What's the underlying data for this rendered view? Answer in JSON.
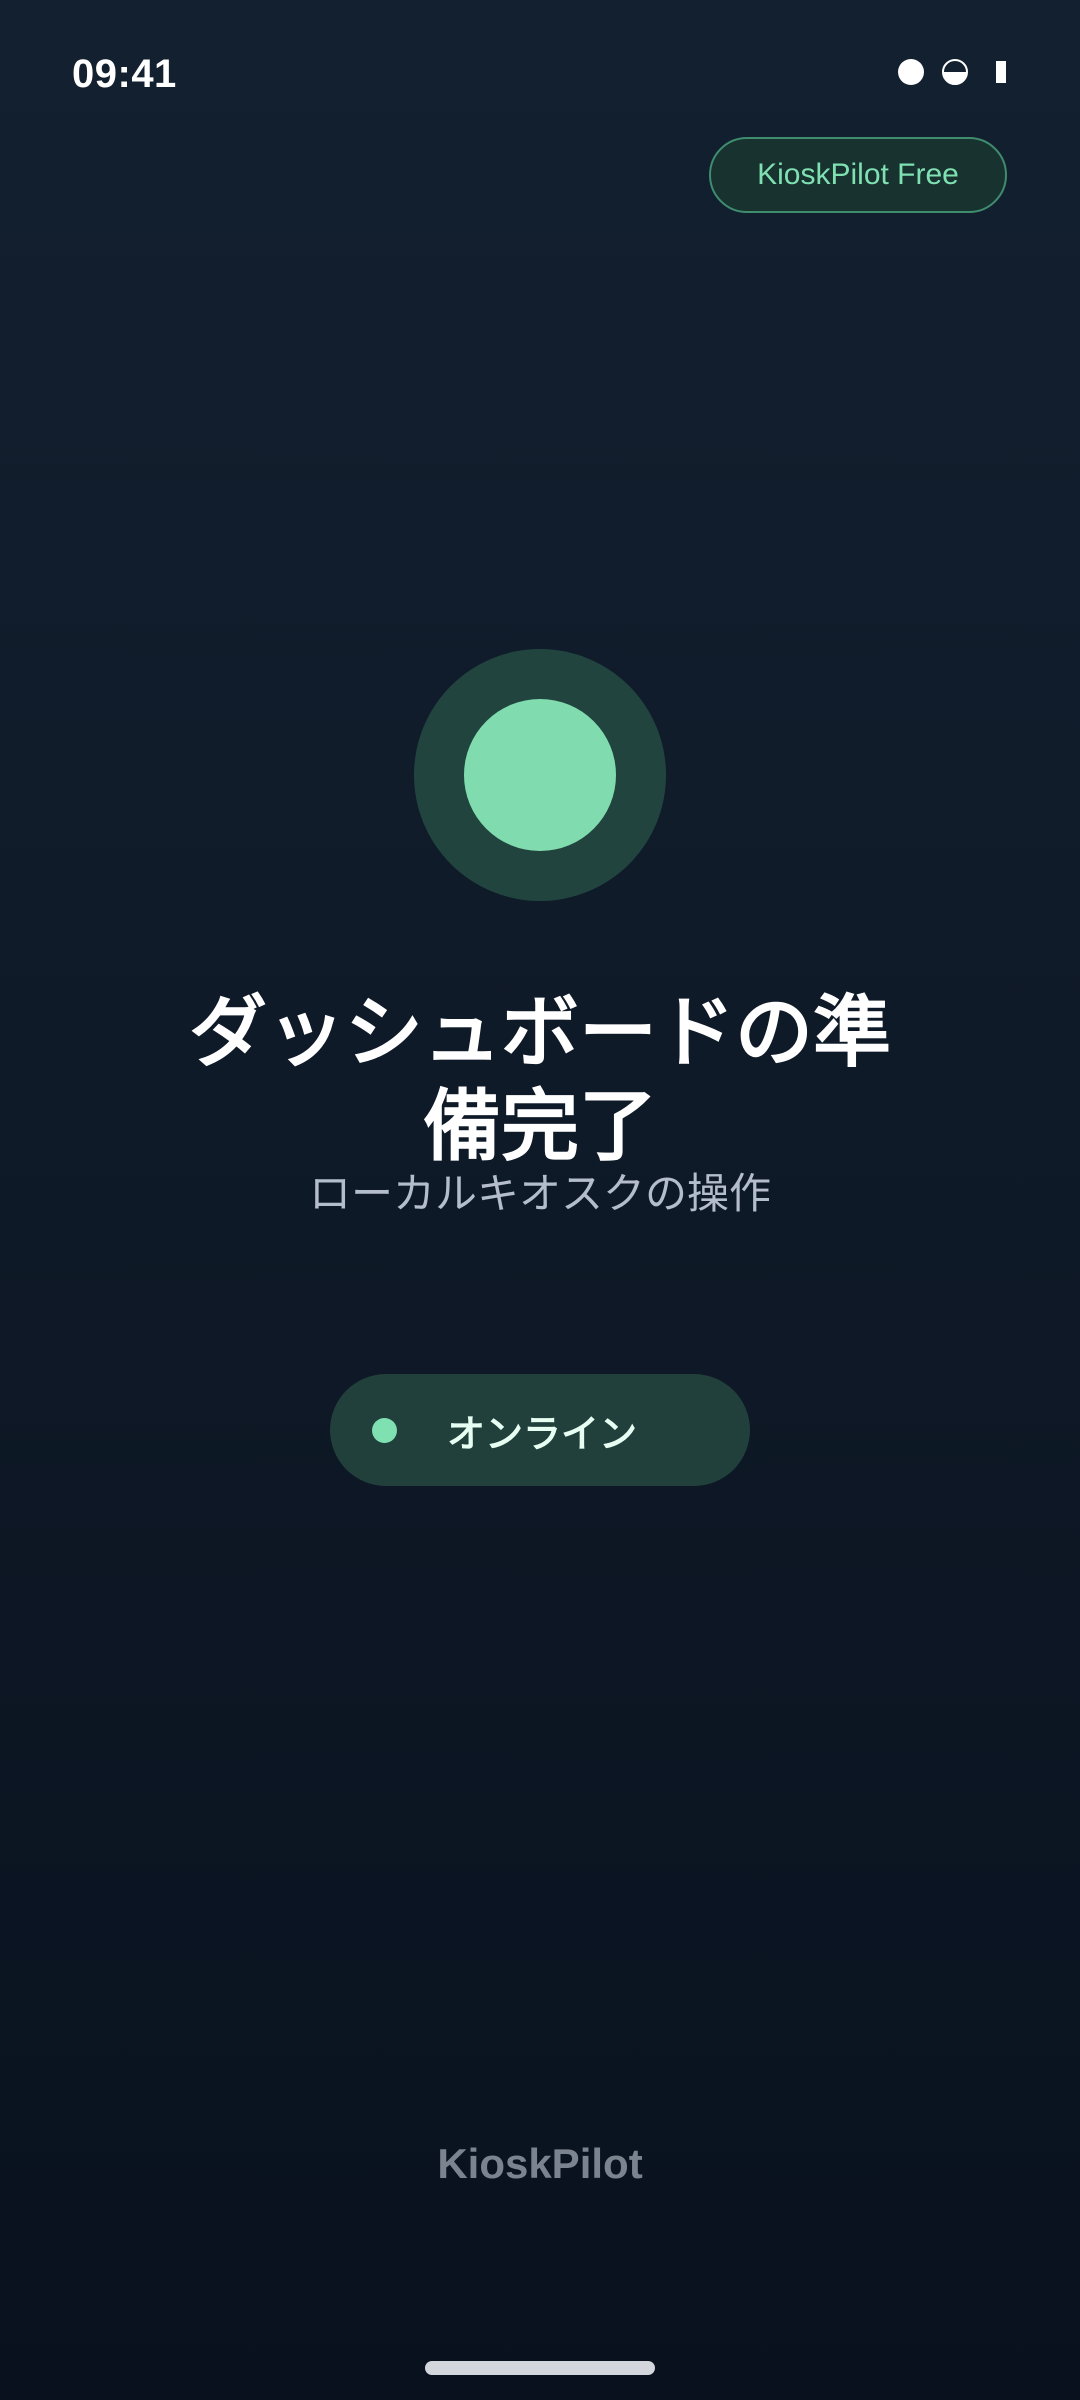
{
  "status_bar": {
    "time": "09:41"
  },
  "header": {
    "plan_chip_label": "KioskPilot Free"
  },
  "main": {
    "title": "ダッシュボードの準備完了",
    "subtitle": "ローカルキオスクの操作",
    "status_pill_label": "オンライン"
  },
  "footer": {
    "brand": "KioskPilot"
  },
  "colors": {
    "accent": "#80dcae",
    "ring": "#22443f",
    "background_top": "#132030",
    "background_bottom": "#09111e"
  },
  "icons": {
    "status_bar": [
      "signal-dot-icon",
      "half-circle-icon",
      "battery-icon"
    ],
    "center": "status-indicator-icon",
    "pill": "online-dot-icon"
  }
}
